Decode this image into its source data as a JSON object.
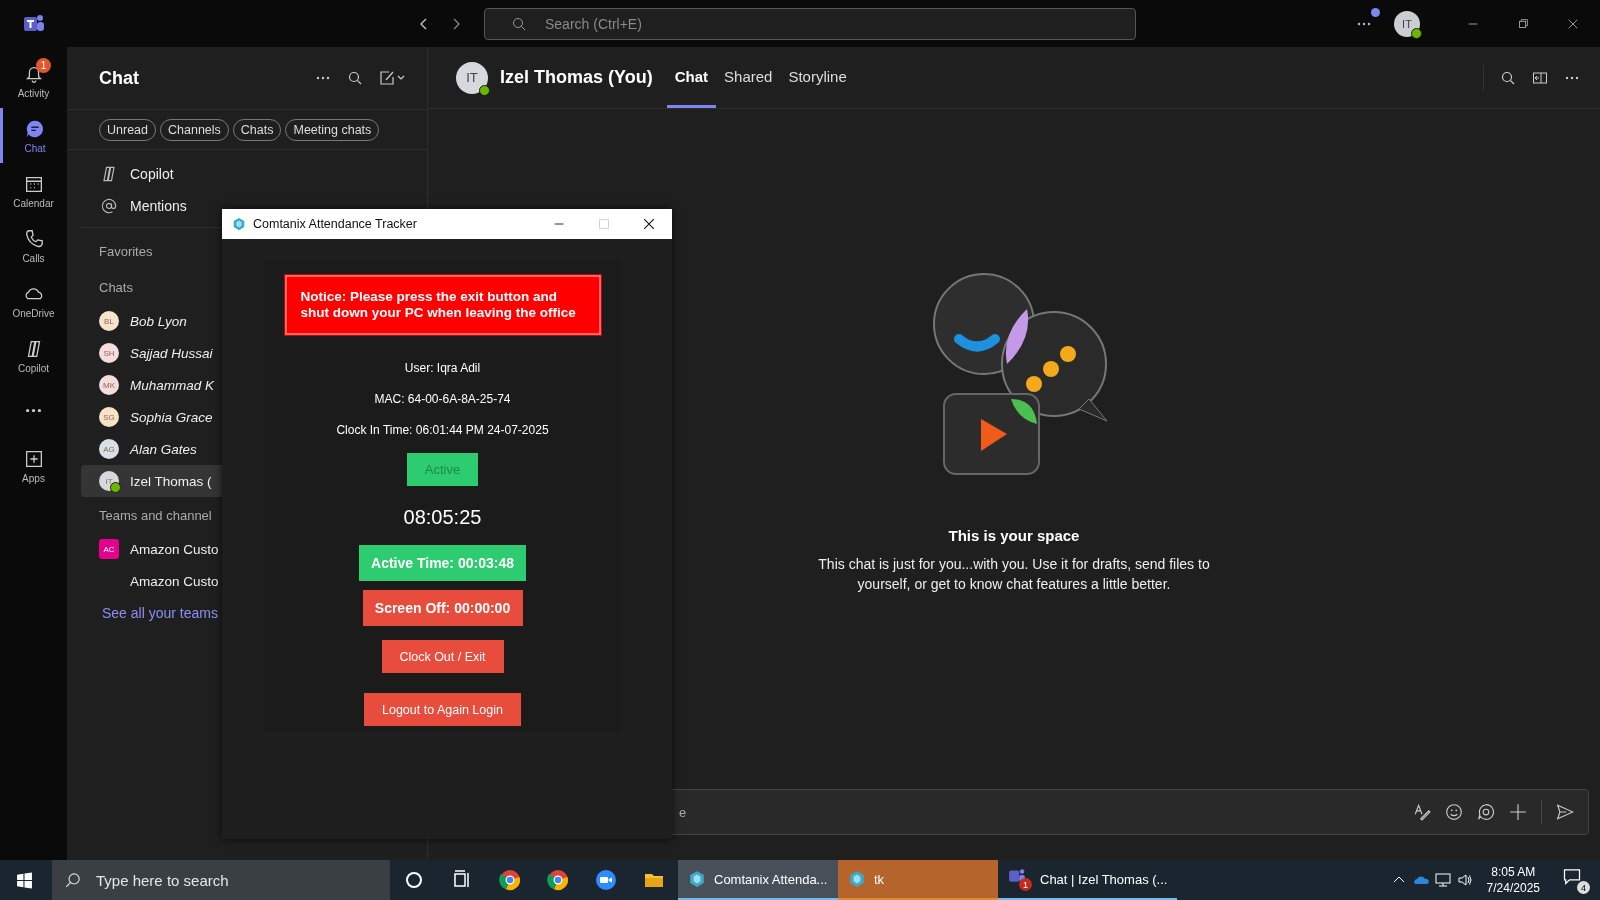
{
  "title_bar": {
    "search_placeholder": "Search (Ctrl+E)",
    "avatar_initials": "IT"
  },
  "app_rail": [
    {
      "kind": "activity",
      "label": "Activity",
      "badge": "1",
      "selected": false
    },
    {
      "kind": "chat",
      "label": "Chat",
      "selected": true
    },
    {
      "kind": "calendar",
      "label": "Calendar",
      "selected": false
    },
    {
      "kind": "calls",
      "label": "Calls",
      "selected": false
    },
    {
      "kind": "onedrive",
      "label": "OneDrive",
      "selected": false
    },
    {
      "kind": "copilot",
      "label": "Copilot",
      "selected": false
    },
    {
      "kind": "more",
      "selected": false
    },
    {
      "kind": "apps",
      "label": "Apps",
      "selected": false
    }
  ],
  "chat_list": {
    "title": "Chat",
    "filters": [
      {
        "label": "Unread",
        "selected": false
      },
      {
        "label": "Channels",
        "selected": false
      },
      {
        "label": "Chats",
        "selected": false
      },
      {
        "label": "Meeting chats",
        "selected": false
      }
    ],
    "pinned": [
      {
        "kind": "copilot",
        "label": "Copilot"
      },
      {
        "kind": "mentions",
        "label": "Mentions"
      }
    ],
    "favorites_heading": "Favorites",
    "chats_heading": "Chats",
    "chats": [
      {
        "initials": "BL",
        "name": "Bob Lyon",
        "color": "#f8e4cc",
        "italic": true,
        "online": false,
        "selected": false
      },
      {
        "initials": "SH",
        "name": "Sajjad Hussai",
        "color": "#f6dcdc",
        "italic": true,
        "online": false,
        "selected": false
      },
      {
        "initials": "MK",
        "name": "Muhammad K",
        "color": "#f7dcdc",
        "italic": true,
        "online": false,
        "selected": false
      },
      {
        "initials": "SG",
        "name": "Sophia Grace",
        "color": "#f8e2c6",
        "italic": true,
        "online": false,
        "selected": false
      },
      {
        "initials": "AG",
        "name": "Alan Gates",
        "color": "#d8dfe6",
        "italic": true,
        "online": false,
        "selected": false
      },
      {
        "initials": "IT",
        "name": "Izel Thomas (",
        "color": "#d5d9dd",
        "italic": false,
        "online": true,
        "selected": true
      }
    ],
    "teams_heading": "Teams and channel",
    "teams": [
      {
        "initials": "AC",
        "name": "Amazon Custo",
        "color": "#e3008c"
      },
      {
        "name": "Amazon Custo"
      }
    ],
    "see_all": "See all your teams"
  },
  "conversation": {
    "avatar_initials": "IT",
    "online": true,
    "name": "Izel Thomas (You)",
    "tabs": [
      {
        "label": "Chat",
        "selected": true
      },
      {
        "label": "Shared",
        "selected": false
      },
      {
        "label": "Storyline",
        "selected": false
      }
    ],
    "empty_title": "This is your space",
    "empty_text": "This chat is just for you...with you. Use it for drafts, send files to yourself, or get to know chat features a little better.",
    "compose_placeholder": "e"
  },
  "dialog": {
    "title": "Comtanix Attendance Tracker",
    "notice": "Notice: Please press the exit button and shut down your PC when leaving the office",
    "info": [
      "User: Iqra Adil",
      "MAC: 64-00-6A-8A-25-74",
      "Clock In Time: 06:01:44 PM 24-07-2025"
    ],
    "status": "Active",
    "clock": "08:05:25",
    "timers": [
      {
        "kind": "active",
        "label": "Active Time: 00:03:48"
      },
      {
        "kind": "screen_off",
        "label": "Screen Off: 00:00:00"
      }
    ],
    "buttons": [
      "Clock Out / Exit",
      "Logout to Again Login"
    ]
  },
  "taskbar": {
    "search_placeholder": "Type here to search",
    "pinned": [
      {
        "kind": "cortana"
      },
      {
        "kind": "taskview"
      },
      {
        "kind": "chrome"
      },
      {
        "kind": "chrome"
      },
      {
        "kind": "zoom"
      },
      {
        "kind": "files"
      }
    ],
    "windows": [
      {
        "kind": "tracker",
        "label": "Comtanix Attenda...",
        "selected": true,
        "flashing": false
      },
      {
        "kind": "tracker",
        "label": "tk",
        "selected": false,
        "flashing": true
      },
      {
        "kind": "teams",
        "label": "Chat | Izel Thomas (...",
        "selected": false,
        "flashing": false,
        "badge": "1"
      }
    ],
    "time": "8:05 AM",
    "date": "7/24/2025",
    "notifications": "4"
  }
}
